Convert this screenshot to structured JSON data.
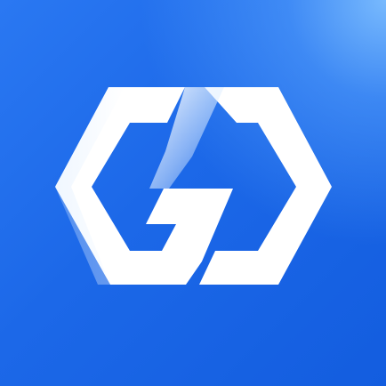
{
  "app_icon": {
    "logo_icon": "hexagon-g-logo-icon",
    "colors": {
      "background_main": "#1b66e6",
      "background_highlight": "#7dbeff",
      "mark": "#ffffff"
    }
  }
}
